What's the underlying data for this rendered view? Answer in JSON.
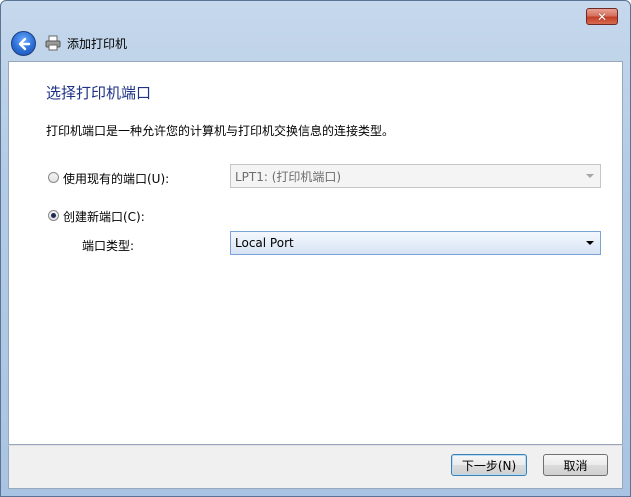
{
  "window": {
    "title": "添加打印机",
    "close_label": "✕"
  },
  "page": {
    "heading": "选择打印机端口",
    "description": "打印机端口是一种允许您的计算机与打印机交换信息的连接类型。"
  },
  "options": {
    "existing_port": {
      "label": "使用现有的端口(U):",
      "selected": false,
      "value": "LPT1: (打印机端口)"
    },
    "new_port": {
      "label": "创建新端口(C):",
      "selected": true,
      "type_label": "端口类型:",
      "type_value": "Local Port"
    }
  },
  "buttons": {
    "next": "下一步(N)",
    "cancel": "取消"
  }
}
